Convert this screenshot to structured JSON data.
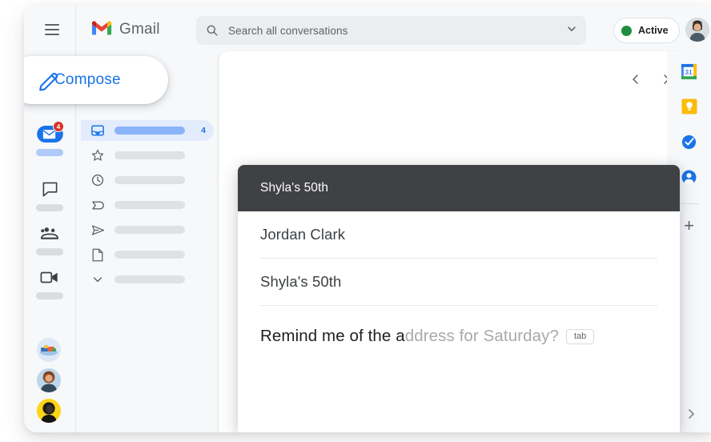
{
  "app": {
    "name": "Gmail",
    "menu_icon": "hamburger-icon"
  },
  "search": {
    "placeholder": "Search all conversations",
    "icon": "search-icon",
    "options_icon": "chevron-down-icon"
  },
  "status": {
    "label": "Active",
    "dot_color": "#1e8e3e"
  },
  "compose_button": {
    "label": "Compose",
    "icon": "pencil-icon",
    "color": "#1a73e8"
  },
  "left_rail": {
    "items": [
      {
        "name": "mail",
        "icon": "mail-icon",
        "badge": "4",
        "active": true
      },
      {
        "name": "chat",
        "icon": "chat-icon",
        "badge": "",
        "active": false
      },
      {
        "name": "spaces",
        "icon": "spaces-icon",
        "badge": "",
        "active": false
      },
      {
        "name": "meet",
        "icon": "video-camera-icon",
        "badge": "",
        "active": false
      }
    ],
    "avatars": [
      {
        "name": "avatar-illustration"
      },
      {
        "name": "avatar-person-1"
      },
      {
        "name": "avatar-person-2"
      }
    ]
  },
  "folders": [
    {
      "icon": "inbox-icon",
      "count": "4",
      "selected": true
    },
    {
      "icon": "star-icon",
      "count": "",
      "selected": false
    },
    {
      "icon": "clock-icon",
      "count": "",
      "selected": false
    },
    {
      "icon": "important-icon",
      "count": "",
      "selected": false
    },
    {
      "icon": "send-icon",
      "count": "",
      "selected": false
    },
    {
      "icon": "draft-icon",
      "count": "",
      "selected": false
    },
    {
      "icon": "chevron-down-icon",
      "count": "",
      "selected": false
    }
  ],
  "pager": {
    "prev_icon": "chevron-left-icon",
    "next_icon": "chevron-right-icon"
  },
  "compose_dialog": {
    "title": "Shyla's 50th",
    "recipient": "Jordan Clark",
    "subject": "Shyla's 50th",
    "body_typed": "Remind me of the a",
    "body_suggestion": "ddress for Saturday?",
    "tab_hint": "tab"
  },
  "right_rail": {
    "items": [
      {
        "name": "google-calendar-icon",
        "label": "31"
      },
      {
        "name": "google-keep-icon",
        "label": ""
      },
      {
        "name": "google-tasks-icon",
        "label": ""
      },
      {
        "name": "google-contacts-icon",
        "label": ""
      }
    ],
    "add_label": "+"
  },
  "bottom": {
    "expand_icon": "chevron-right-icon"
  }
}
